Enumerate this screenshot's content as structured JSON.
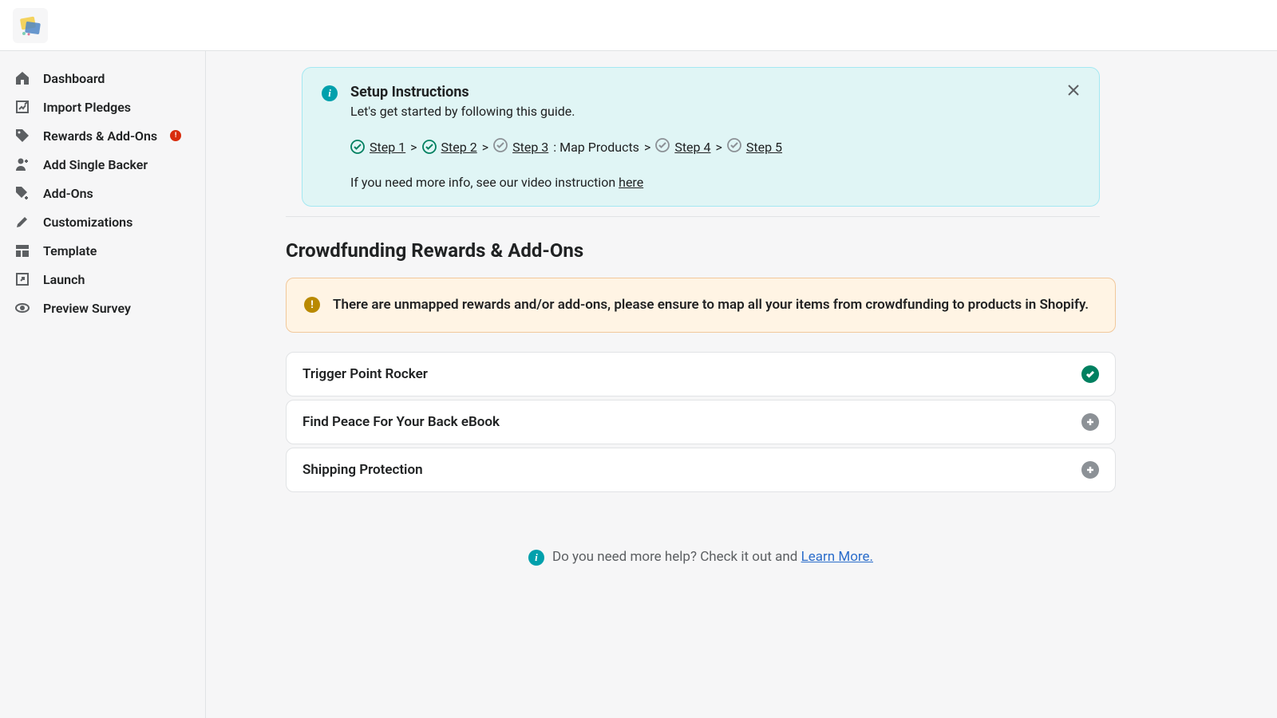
{
  "sidebar": {
    "items": [
      {
        "label": "Dashboard"
      },
      {
        "label": "Import Pledges"
      },
      {
        "label": "Rewards & Add-Ons",
        "badge": "!"
      },
      {
        "label": "Add Single Backer"
      },
      {
        "label": "Add-Ons"
      },
      {
        "label": "Customizations"
      },
      {
        "label": "Template"
      },
      {
        "label": "Launch"
      },
      {
        "label": "Preview Survey"
      }
    ]
  },
  "setup": {
    "title": "Setup Instructions",
    "subtitle": "Let's get started by following this guide.",
    "steps": {
      "s1": "Step 1",
      "s2": "Step 2",
      "s3": "Step 3",
      "s3_label": ": Map Products",
      "s4": "Step 4",
      "s5": "Step 5",
      "sep": ">"
    },
    "video_text": "If you need more info, see our video instruction ",
    "video_link": "here"
  },
  "page": {
    "title": "Crowdfunding Rewards & Add-Ons"
  },
  "warning": {
    "text": "There are unmapped rewards and/or add-ons, please ensure to map all your items from crowdfunding to products in Shopify."
  },
  "items": [
    {
      "name": "Trigger Point Rocker",
      "status": "done"
    },
    {
      "name": "Find Peace For Your Back eBook",
      "status": "add"
    },
    {
      "name": "Shipping Protection",
      "status": "add"
    }
  ],
  "help": {
    "text": "Do you need more help? Check it out and ",
    "link": "Learn More."
  }
}
